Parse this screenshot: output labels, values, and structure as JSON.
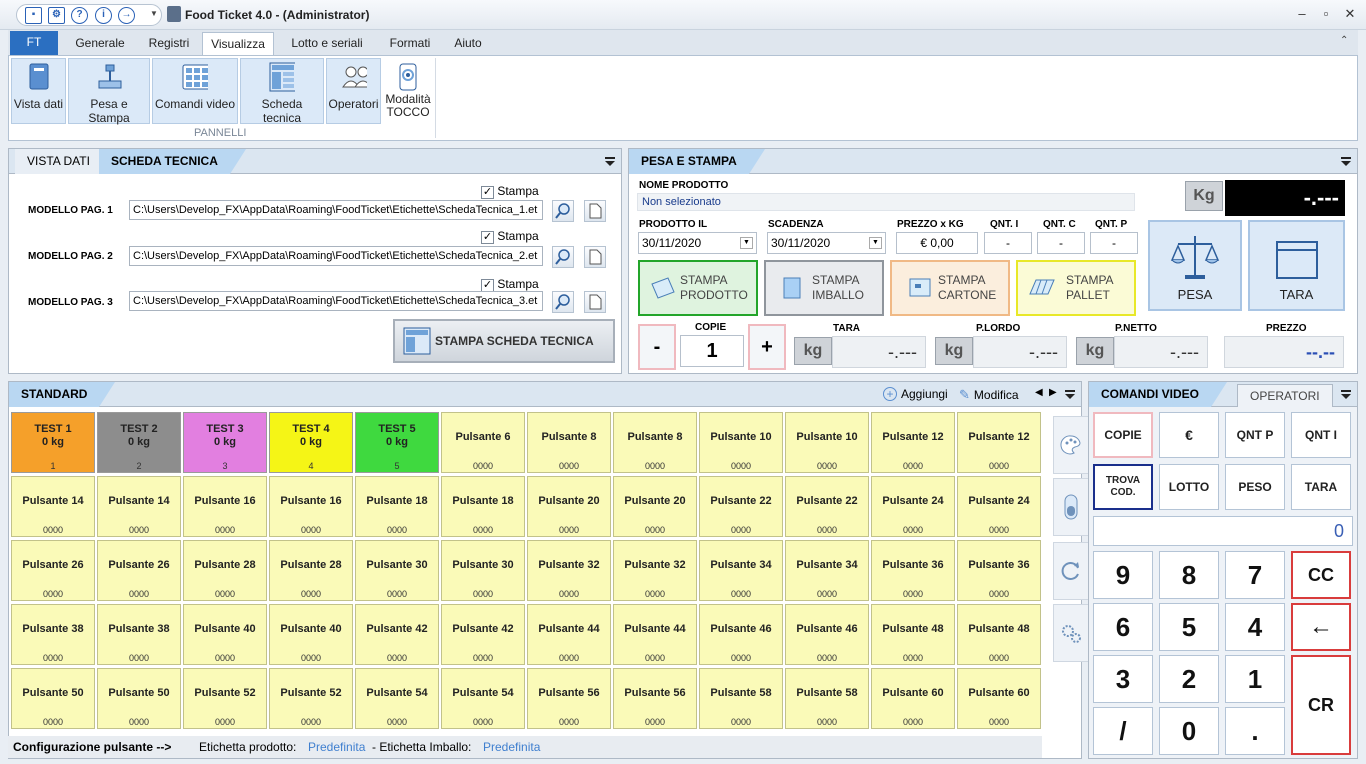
{
  "app": {
    "title": "Food Ticket 4.0 - (Administrator)"
  },
  "ribbon": {
    "ft": "FT",
    "tabs": [
      "Generale",
      "Registri",
      "Visualizza",
      "Lotto e seriali",
      "Formati",
      "Aiuto"
    ],
    "buttons": [
      "Vista dati",
      "Pesa e Stampa",
      "Comandi video",
      "Scheda tecnica",
      "Operatori"
    ],
    "tocco_1": "Modalità",
    "tocco_2": "TOCCO",
    "group_label": "PANNELLI"
  },
  "scheda": {
    "tab_inactive": "VISTA DATI",
    "tab_active": "SCHEDA TECNICA",
    "stampa_label": "Stampa",
    "rows": [
      {
        "label": "MODELLO PAG. 1",
        "path": "C:\\Users\\Develop_FX\\AppData\\Roaming\\FoodTicket\\Etichette\\SchedaTecnica_1.et"
      },
      {
        "label": "MODELLO PAG. 2",
        "path": "C:\\Users\\Develop_FX\\AppData\\Roaming\\FoodTicket\\Etichette\\SchedaTecnica_2.et"
      },
      {
        "label": "MODELLO PAG. 3",
        "path": "C:\\Users\\Develop_FX\\AppData\\Roaming\\FoodTicket\\Etichette\\SchedaTecnica_3.et"
      }
    ],
    "print_button": "STAMPA SCHEDA TECNICA"
  },
  "pesa": {
    "tab": "PESA E STAMPA",
    "nome_label": "NOME PRODOTTO",
    "nome_value": "Non selezionato",
    "kg_label": "Kg",
    "weight_display": "-.---",
    "prodotto_il_label": "PRODOTTO IL",
    "prodotto_il": "30/11/2020",
    "scadenza_label": "SCADENZA",
    "scadenza": "30/11/2020",
    "prezzo_label": "PREZZO x KG",
    "prezzo": "€ 0,00",
    "qnt_i_label": "QNT. I",
    "qnt_i": "-",
    "qnt_c_label": "QNT. C",
    "qnt_c": "-",
    "qnt_p_label": "QNT. P",
    "qnt_p": "-",
    "stampa_prodotto": [
      "STAMPA",
      "PRODOTTO"
    ],
    "stampa_imballo": [
      "STAMPA",
      "IMBALLO"
    ],
    "stampa_cartone": [
      "STAMPA",
      "CARTONE"
    ],
    "stampa_pallet": [
      "STAMPA",
      "PALLET"
    ],
    "pesa_btn": "PESA",
    "tara_btn": "TARA",
    "copie_label": "COPIE",
    "copie": "1",
    "minus": "-",
    "plus": "+",
    "tara_label": "TARA",
    "plordo_label": "P.LORDO",
    "pnetto_label": "P.NETTO",
    "prezzo2_label": "PREZZO",
    "kg_unit": "kg",
    "tara_val": "-.---",
    "plordo_val": "-.---",
    "pnetto_val": "-.---",
    "prezzo_val": "--.--"
  },
  "standard": {
    "tab": "STANDARD",
    "aggiungi": "Aggiungi",
    "modifica": "Modifica",
    "buttons": [
      {
        "l1": "TEST 1",
        "l2": "0 kg",
        "code": "1",
        "color": "#f5a02a"
      },
      {
        "l1": "TEST 2",
        "l2": "0 kg",
        "code": "2",
        "color": "#8d8d8d"
      },
      {
        "l1": "TEST 3",
        "l2": "0 kg",
        "code": "3",
        "color": "#e27fe0"
      },
      {
        "l1": "TEST 4",
        "l2": "0 kg",
        "code": "4",
        "color": "#f5f516"
      },
      {
        "l1": "TEST 5",
        "l2": "0 kg",
        "code": "5",
        "color": "#3fd93f"
      },
      {
        "l1": "Pulsante 6",
        "code": "0000"
      },
      {
        "l1": "Pulsante 8",
        "code": "0000"
      },
      {
        "l1": "Pulsante 8",
        "code": "0000"
      },
      {
        "l1": "Pulsante 10",
        "code": "0000"
      },
      {
        "l1": "Pulsante 10",
        "code": "0000"
      },
      {
        "l1": "Pulsante 12",
        "code": "0000"
      },
      {
        "l1": "Pulsante 12",
        "code": "0000"
      },
      {
        "l1": "Pulsante 14",
        "code": "0000"
      },
      {
        "l1": "Pulsante 14",
        "code": "0000"
      },
      {
        "l1": "Pulsante 16",
        "code": "0000"
      },
      {
        "l1": "Pulsante 16",
        "code": "0000"
      },
      {
        "l1": "Pulsante 18",
        "code": "0000"
      },
      {
        "l1": "Pulsante 18",
        "code": "0000"
      },
      {
        "l1": "Pulsante 20",
        "code": "0000"
      },
      {
        "l1": "Pulsante 20",
        "code": "0000"
      },
      {
        "l1": "Pulsante 22",
        "code": "0000"
      },
      {
        "l1": "Pulsante 22",
        "code": "0000"
      },
      {
        "l1": "Pulsante 24",
        "code": "0000"
      },
      {
        "l1": "Pulsante 24",
        "code": "0000"
      },
      {
        "l1": "Pulsante 26",
        "code": "0000"
      },
      {
        "l1": "Pulsante 26",
        "code": "0000"
      },
      {
        "l1": "Pulsante 28",
        "code": "0000"
      },
      {
        "l1": "Pulsante 28",
        "code": "0000"
      },
      {
        "l1": "Pulsante 30",
        "code": "0000"
      },
      {
        "l1": "Pulsante 30",
        "code": "0000"
      },
      {
        "l1": "Pulsante 32",
        "code": "0000"
      },
      {
        "l1": "Pulsante 32",
        "code": "0000"
      },
      {
        "l1": "Pulsante 34",
        "code": "0000"
      },
      {
        "l1": "Pulsante 34",
        "code": "0000"
      },
      {
        "l1": "Pulsante 36",
        "code": "0000"
      },
      {
        "l1": "Pulsante 36",
        "code": "0000"
      },
      {
        "l1": "Pulsante 38",
        "code": "0000"
      },
      {
        "l1": "Pulsante 38",
        "code": "0000"
      },
      {
        "l1": "Pulsante 40",
        "code": "0000"
      },
      {
        "l1": "Pulsante 40",
        "code": "0000"
      },
      {
        "l1": "Pulsante 42",
        "code": "0000"
      },
      {
        "l1": "Pulsante 42",
        "code": "0000"
      },
      {
        "l1": "Pulsante 44",
        "code": "0000"
      },
      {
        "l1": "Pulsante 44",
        "code": "0000"
      },
      {
        "l1": "Pulsante 46",
        "code": "0000"
      },
      {
        "l1": "Pulsante 46",
        "code": "0000"
      },
      {
        "l1": "Pulsante 48",
        "code": "0000"
      },
      {
        "l1": "Pulsante 48",
        "code": "0000"
      },
      {
        "l1": "Pulsante 50",
        "code": "0000"
      },
      {
        "l1": "Pulsante 50",
        "code": "0000"
      },
      {
        "l1": "Pulsante 52",
        "code": "0000"
      },
      {
        "l1": "Pulsante 52",
        "code": "0000"
      },
      {
        "l1": "Pulsante 54",
        "code": "0000"
      },
      {
        "l1": "Pulsante 54",
        "code": "0000"
      },
      {
        "l1": "Pulsante 56",
        "code": "0000"
      },
      {
        "l1": "Pulsante 56",
        "code": "0000"
      },
      {
        "l1": "Pulsante 58",
        "code": "0000"
      },
      {
        "l1": "Pulsante 58",
        "code": "0000"
      },
      {
        "l1": "Pulsante 60",
        "code": "0000"
      },
      {
        "l1": "Pulsante 60",
        "code": "0000"
      }
    ]
  },
  "status": {
    "config": "Configurazione pulsante -->",
    "etichetta_prodotto": "Etichetta prodotto:",
    "predefinita1": "Predefinita",
    "etichetta_imballo": "- Etichetta Imballo:",
    "predefinita2": "Predefinita"
  },
  "comandi": {
    "tab_active": "COMANDI VIDEO",
    "tab_inactive": "OPERATORI",
    "row1": [
      "COPIE",
      "€",
      "QNT P",
      "QNT I"
    ],
    "row2_trova": [
      "TROVA",
      "COD."
    ],
    "row2": [
      "LOTTO",
      "PESO",
      "TARA"
    ],
    "display": "0",
    "keys": [
      "9",
      "8",
      "7",
      "6",
      "5",
      "4",
      "3",
      "2",
      "1",
      "/",
      "0",
      "."
    ],
    "cc": "CC",
    "back": "←",
    "cr": "CR"
  },
  "colors": {
    "accent": "#2b6fc1",
    "tab_active": "#b9d7f2",
    "button_yellow": "#fafab8",
    "alert_red": "#d93c3c"
  }
}
